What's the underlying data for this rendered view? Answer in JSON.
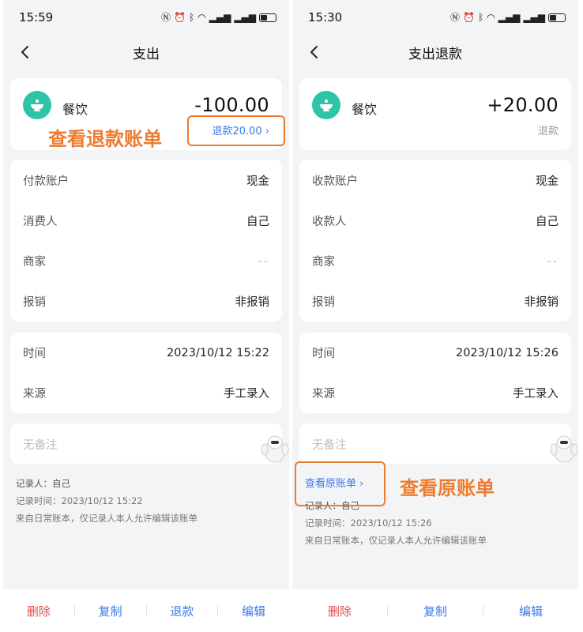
{
  "left": {
    "status_time": "15:59",
    "nav_title": "支出",
    "category": "餐饮",
    "amount": "-100.00",
    "refund_link": "退款20.00",
    "info_rows": [
      {
        "label": "付款账户",
        "value": "现金"
      },
      {
        "label": "消费人",
        "value": "自己"
      },
      {
        "label": "商家",
        "value": "--"
      },
      {
        "label": "报销",
        "value": "非报销"
      }
    ],
    "time_rows": [
      {
        "label": "时间",
        "value": "2023/10/12 15:22"
      },
      {
        "label": "来源",
        "value": "手工录入"
      }
    ],
    "note_placeholder": "无备注",
    "recorder": "记录人：自己",
    "record_time": "记录时间：2023/10/12 15:22",
    "source_note": "来自日常账本，仅记录人本人允许编辑该账单",
    "bottom_actions": [
      "删除",
      "复制",
      "退款",
      "编辑"
    ]
  },
  "right": {
    "status_time": "15:30",
    "nav_title": "支出退款",
    "category": "餐饮",
    "amount": "+20.00",
    "amount_sub": "退款",
    "info_rows": [
      {
        "label": "收款账户",
        "value": "现金"
      },
      {
        "label": "收款人",
        "value": "自己"
      },
      {
        "label": "商家",
        "value": "--"
      },
      {
        "label": "报销",
        "value": "非报销"
      }
    ],
    "time_rows": [
      {
        "label": "时间",
        "value": "2023/10/12 15:26"
      },
      {
        "label": "来源",
        "value": "手工录入"
      }
    ],
    "note_placeholder": "无备注",
    "orig_link": "查看原账单",
    "recorder": "记录人：自己",
    "record_time": "记录时间：2023/10/12 15:26",
    "source_note": "来自日常账本，仅记录人本人允许编辑该账单",
    "bottom_actions": [
      "删除",
      "复制",
      "编辑"
    ]
  },
  "annotations": {
    "view_refund": "查看退款账单",
    "view_original": "查看原账单"
  },
  "colors": {
    "accent_blue": "#3b7be8",
    "danger_red": "#e54b4b",
    "annotation_orange": "#ee7a2e",
    "category_teal": "#2ec4a8"
  },
  "icons": {
    "category": "bowl-icon",
    "back": "chevron-left-icon",
    "link_arrow": "chevron-right-icon"
  }
}
